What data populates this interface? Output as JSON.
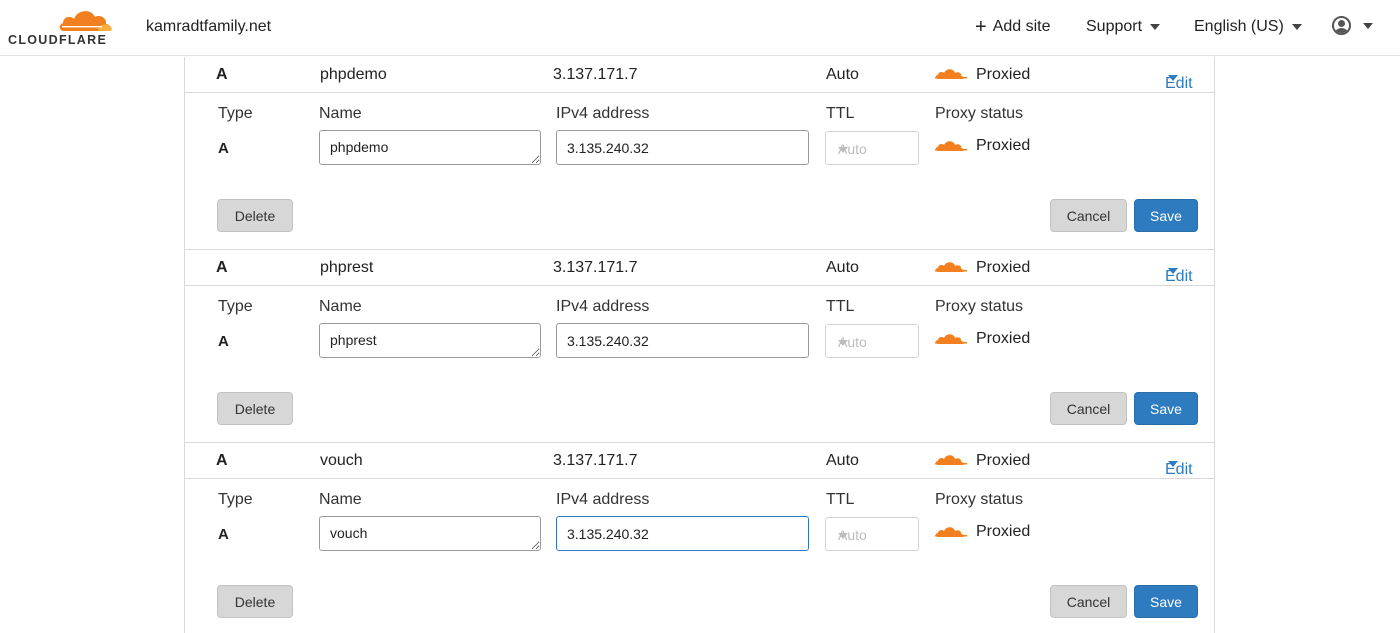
{
  "header": {
    "logo_text": "CLOUDFLARE",
    "domain": "kamradtfamily.net",
    "add_site": "Add site",
    "support": "Support",
    "language": "English (US)"
  },
  "form_labels": {
    "type": "Type",
    "name": "Name",
    "ipv4": "IPv4 address",
    "ttl": "TTL",
    "proxy_status": "Proxy status"
  },
  "buttons": {
    "delete": "Delete",
    "cancel": "Cancel",
    "save": "Save",
    "edit": "Edit"
  },
  "records": [
    {
      "type": "A",
      "name": "phpdemo",
      "content": "3.137.171.7",
      "ttl": "Auto",
      "proxy": "Proxied",
      "form": {
        "type": "A",
        "name": "phpdemo",
        "ipv4": "3.135.240.32",
        "ttl": "Auto",
        "proxy": "Proxied"
      }
    },
    {
      "type": "A",
      "name": "phprest",
      "content": "3.137.171.7",
      "ttl": "Auto",
      "proxy": "Proxied",
      "form": {
        "type": "A",
        "name": "phprest",
        "ipv4": "3.135.240.32",
        "ttl": "Auto",
        "proxy": "Proxied"
      }
    },
    {
      "type": "A",
      "name": "vouch",
      "content": "3.137.171.7",
      "ttl": "Auto",
      "proxy": "Proxied",
      "form": {
        "type": "A",
        "name": "vouch",
        "ipv4": "3.135.240.32",
        "ttl": "Auto",
        "proxy": "Proxied"
      }
    }
  ],
  "colors": {
    "accent": "#2f7bbf",
    "cloud": "#f38020",
    "button_gray": "#d7d7d7"
  }
}
